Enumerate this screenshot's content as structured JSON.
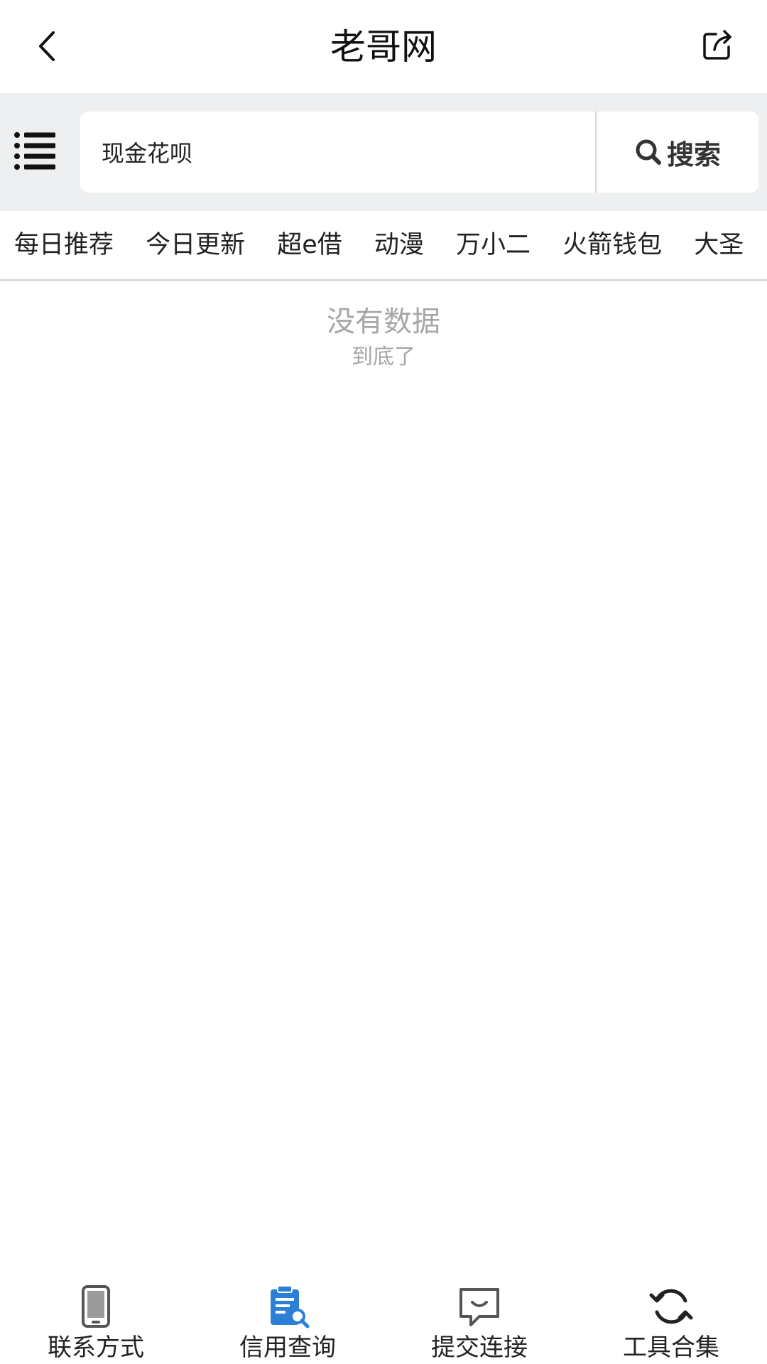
{
  "header": {
    "title": "老哥网"
  },
  "search": {
    "value": "现金花呗",
    "button_label": "搜索"
  },
  "tabs": [
    "每日推荐",
    "今日更新",
    "超e借",
    "动漫",
    "万小二",
    "火箭钱包",
    "大圣"
  ],
  "empty_state": {
    "main": "没有数据",
    "sub": "到底了"
  },
  "bottom_nav": [
    {
      "label": "联系方式",
      "icon": "phone-icon"
    },
    {
      "label": "信用查询",
      "icon": "clipboard-search-icon"
    },
    {
      "label": "提交连接",
      "icon": "chat-icon"
    },
    {
      "label": "工具合集",
      "icon": "refresh-icon"
    }
  ],
  "colors": {
    "accent": "#2b7fd6",
    "band": "#eeeff1"
  }
}
